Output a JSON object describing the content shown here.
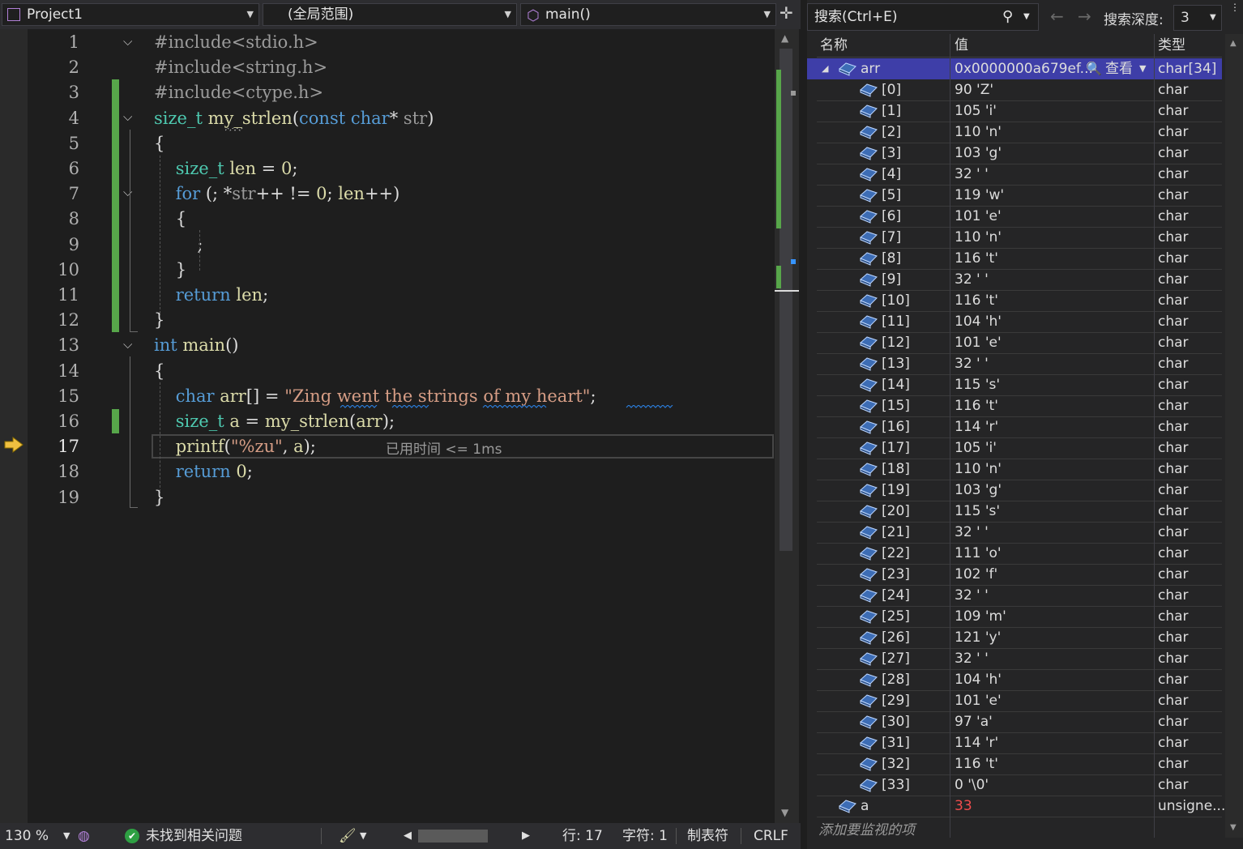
{
  "navbar": {
    "project": "Project1",
    "scope": "(全局范围)",
    "function": "main()"
  },
  "code_lines": [
    {
      "n": "1",
      "html": "<span class='pp'>#include&lt;stdio.h&gt;</span>"
    },
    {
      "n": "2",
      "html": "<span class='pp'>#include&lt;string.h&gt;</span>"
    },
    {
      "n": "3",
      "html": "<span class='pp'>#include&lt;ctype.h&gt;</span>"
    },
    {
      "n": "4",
      "html": "<span class='ty'>size_t</span> <span class='fn'>my_strlen</span>(<span class='kw'>const</span> <span class='kw'>char</span>* <span class='cm'>str</span>)"
    },
    {
      "n": "5",
      "html": "{"
    },
    {
      "n": "6",
      "html": "    <span class='ty'>size_t</span> <span class='fn'>len</span> = <span class='fn'>0</span>;"
    },
    {
      "n": "7",
      "html": "    <span class='kw'>for</span> (; *<span class='cm'>str</span>++ != <span class='fn'>0</span>; <span class='fn'>len</span>++)"
    },
    {
      "n": "8",
      "html": "    {"
    },
    {
      "n": "9",
      "html": "        ;"
    },
    {
      "n": "10",
      "html": "    }"
    },
    {
      "n": "11",
      "html": "    <span class='kw'>return</span> <span class='fn'>len</span>;"
    },
    {
      "n": "12",
      "html": "}"
    },
    {
      "n": "13",
      "html": "<span class='kw'>int</span> <span class='fn'>main</span>()"
    },
    {
      "n": "14",
      "html": "{"
    },
    {
      "n": "15",
      "html": "    <span class='kw'>char</span> <span class='fn'>arr</span>[] = <span class='str'>\"Zing went the strings of my heart\"</span>;"
    },
    {
      "n": "16",
      "html": "    <span class='ty'>size_t</span> <span class='fn'>a</span> = <span class='fn'>my_strlen</span>(<span class='fn'>arr</span>);"
    },
    {
      "n": "17",
      "html": "    <span class='fn'>printf</span>(<span class='str'>\"%zu\"</span>, <span class='fn'>a</span>);"
    },
    {
      "n": "18",
      "html": "    <span class='kw'>return</span> <span class='fn'>0</span>;"
    },
    {
      "n": "19",
      "html": "}"
    }
  ],
  "perf_tip": "已用时间 <= 1ms",
  "status": {
    "zoom": "130 %",
    "issues": "未找到相关问题",
    "line": "行: 17",
    "col": "字符: 1",
    "tabs": "制表符",
    "eol": "CRLF"
  },
  "watch": {
    "search_placeholder": "搜索(Ctrl+E)",
    "depth_label": "搜索深度:",
    "depth_value": "3",
    "headers": {
      "name": "名称",
      "value": "值",
      "type": "类型"
    },
    "root": {
      "name": "arr",
      "value": "0x0000000a679ef...",
      "view": "查看",
      "type": "char[34]"
    },
    "items": [
      {
        "name": "[0]",
        "value": "90 'Z'",
        "type": "char"
      },
      {
        "name": "[1]",
        "value": "105 'i'",
        "type": "char"
      },
      {
        "name": "[2]",
        "value": "110 'n'",
        "type": "char"
      },
      {
        "name": "[3]",
        "value": "103 'g'",
        "type": "char"
      },
      {
        "name": "[4]",
        "value": "32 ' '",
        "type": "char"
      },
      {
        "name": "[5]",
        "value": "119 'w'",
        "type": "char"
      },
      {
        "name": "[6]",
        "value": "101 'e'",
        "type": "char"
      },
      {
        "name": "[7]",
        "value": "110 'n'",
        "type": "char"
      },
      {
        "name": "[8]",
        "value": "116 't'",
        "type": "char"
      },
      {
        "name": "[9]",
        "value": "32 ' '",
        "type": "char"
      },
      {
        "name": "[10]",
        "value": "116 't'",
        "type": "char"
      },
      {
        "name": "[11]",
        "value": "104 'h'",
        "type": "char"
      },
      {
        "name": "[12]",
        "value": "101 'e'",
        "type": "char"
      },
      {
        "name": "[13]",
        "value": "32 ' '",
        "type": "char"
      },
      {
        "name": "[14]",
        "value": "115 's'",
        "type": "char"
      },
      {
        "name": "[15]",
        "value": "116 't'",
        "type": "char"
      },
      {
        "name": "[16]",
        "value": "114 'r'",
        "type": "char"
      },
      {
        "name": "[17]",
        "value": "105 'i'",
        "type": "char"
      },
      {
        "name": "[18]",
        "value": "110 'n'",
        "type": "char"
      },
      {
        "name": "[19]",
        "value": "103 'g'",
        "type": "char"
      },
      {
        "name": "[20]",
        "value": "115 's'",
        "type": "char"
      },
      {
        "name": "[21]",
        "value": "32 ' '",
        "type": "char"
      },
      {
        "name": "[22]",
        "value": "111 'o'",
        "type": "char"
      },
      {
        "name": "[23]",
        "value": "102 'f'",
        "type": "char"
      },
      {
        "name": "[24]",
        "value": "32 ' '",
        "type": "char"
      },
      {
        "name": "[25]",
        "value": "109 'm'",
        "type": "char"
      },
      {
        "name": "[26]",
        "value": "121 'y'",
        "type": "char"
      },
      {
        "name": "[27]",
        "value": "32 ' '",
        "type": "char"
      },
      {
        "name": "[28]",
        "value": "104 'h'",
        "type": "char"
      },
      {
        "name": "[29]",
        "value": "101 'e'",
        "type": "char"
      },
      {
        "name": "[30]",
        "value": "97 'a'",
        "type": "char"
      },
      {
        "name": "[31]",
        "value": "114 'r'",
        "type": "char"
      },
      {
        "name": "[32]",
        "value": "116 't'",
        "type": "char"
      },
      {
        "name": "[33]",
        "value": "0 '\\0'",
        "type": "char"
      }
    ],
    "a_row": {
      "name": "a",
      "value": "33",
      "type": "unsigne..."
    },
    "add_watch": "添加要监视的项"
  }
}
